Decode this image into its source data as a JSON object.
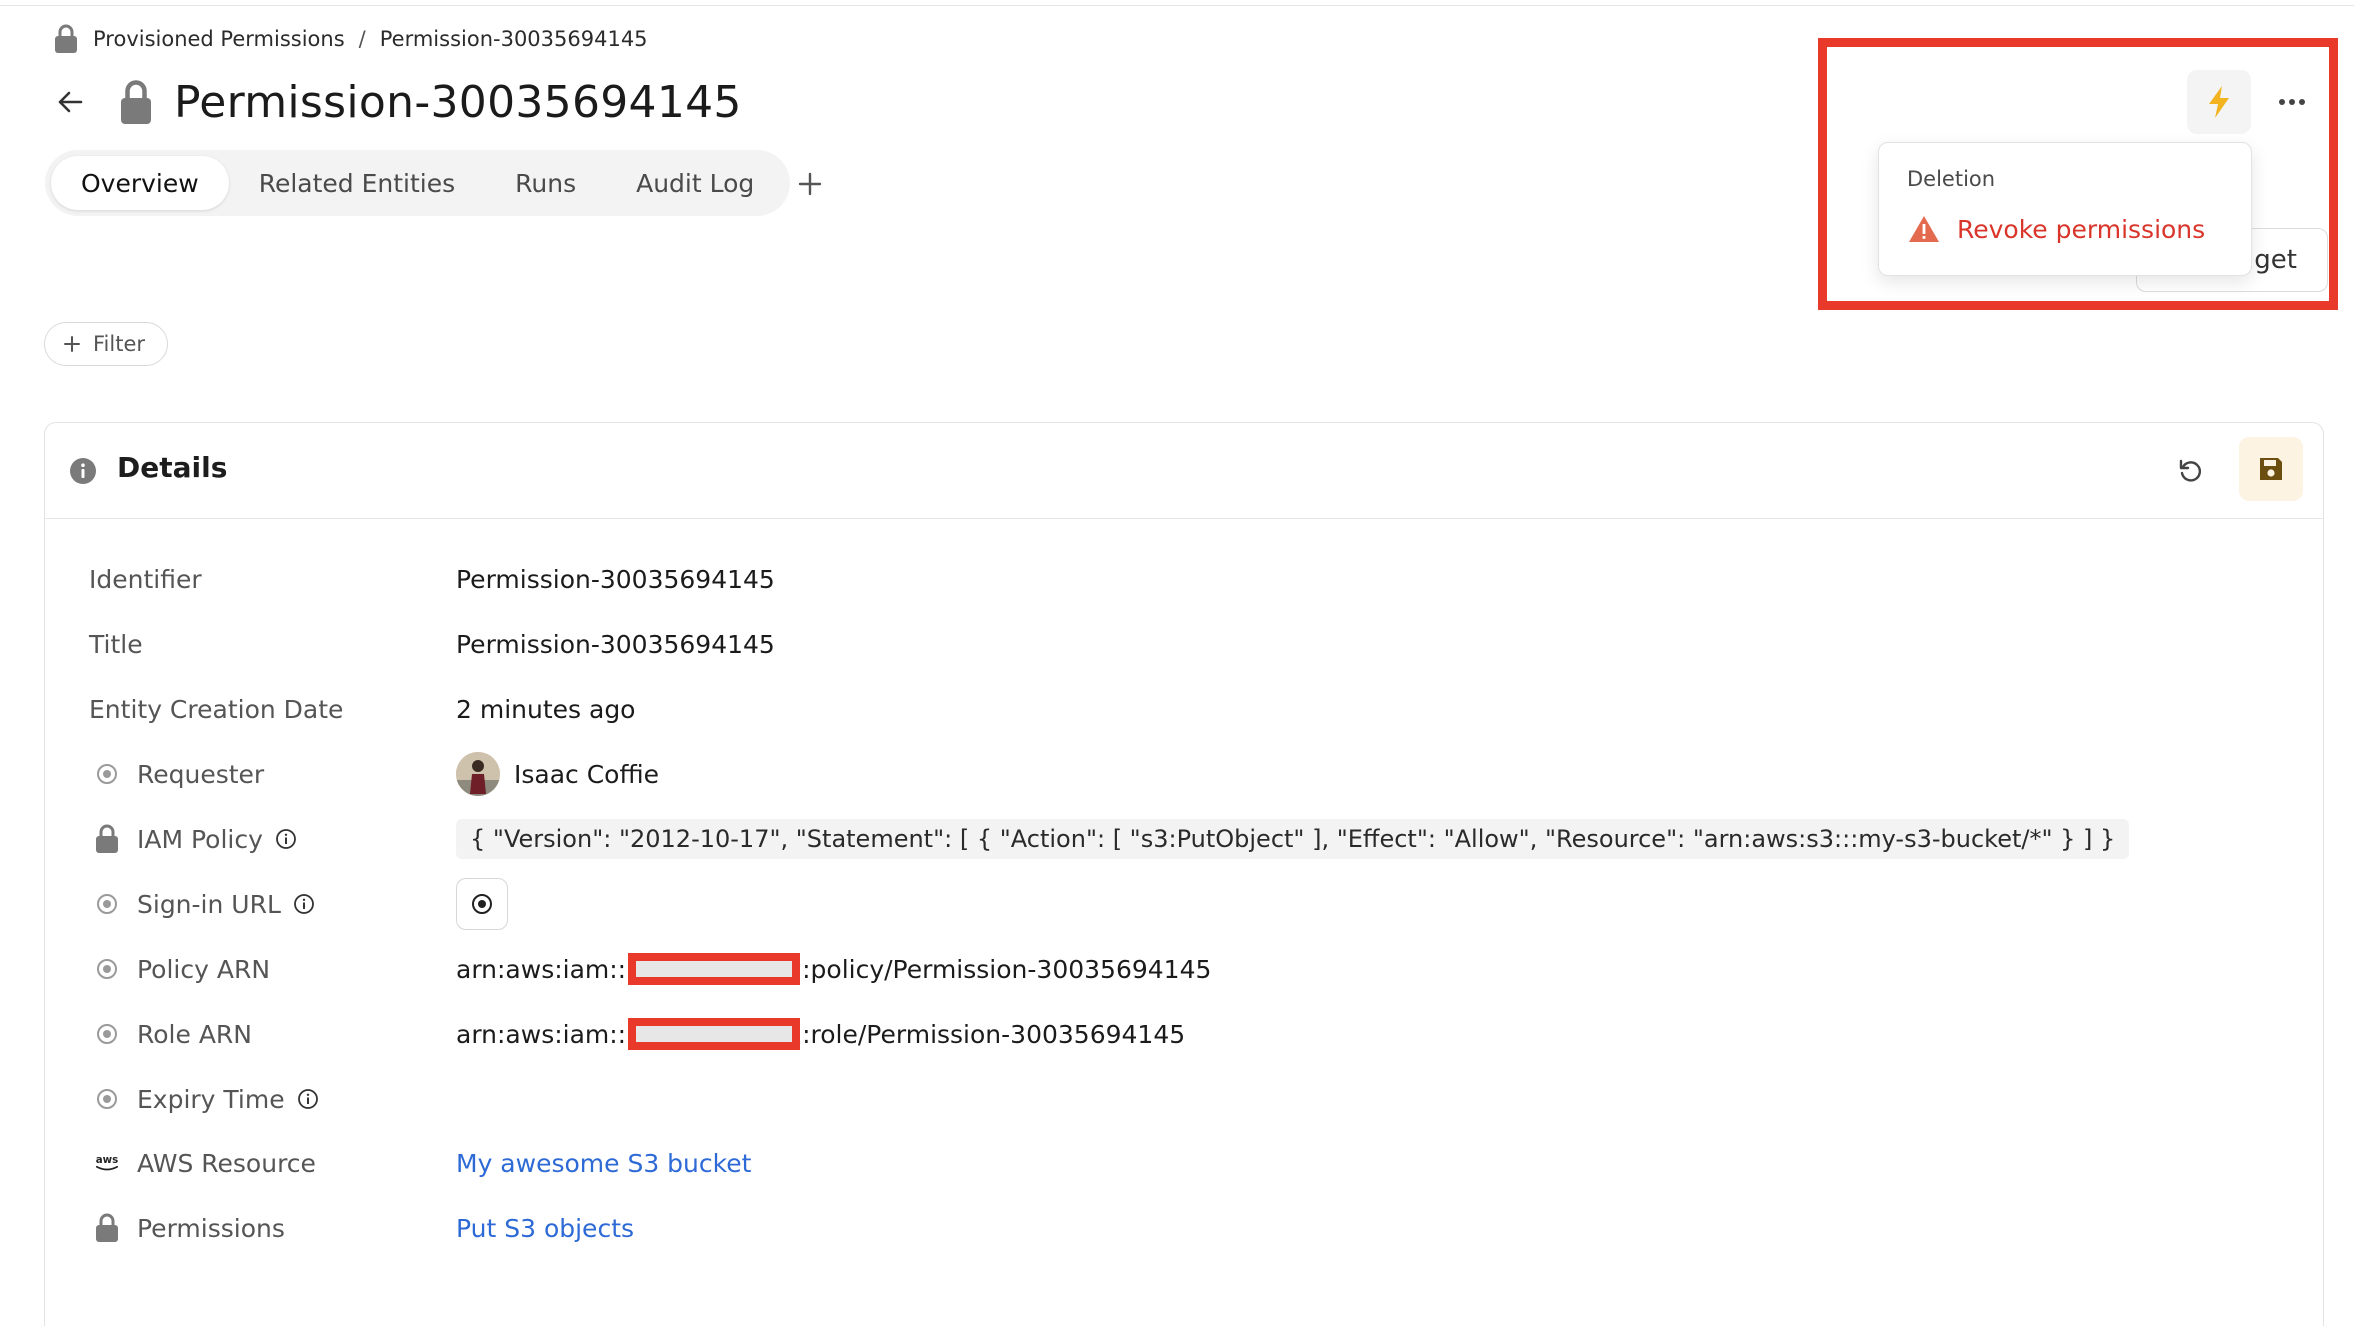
{
  "breadcrumb": {
    "parent": "Provisioned Permissions",
    "separator": "/",
    "current": "Permission-30035694145"
  },
  "header": {
    "title": "Permission-30035694145"
  },
  "tabs": [
    {
      "label": "Overview",
      "active": true
    },
    {
      "label": "Related Entities",
      "active": false
    },
    {
      "label": "Runs",
      "active": false
    },
    {
      "label": "Audit Log",
      "active": false
    }
  ],
  "filter": {
    "label": "Filter"
  },
  "actions_menu": {
    "heading": "Deletion",
    "item": "Revoke permissions",
    "widget_partial": "lget"
  },
  "details": {
    "title": "Details",
    "rows": {
      "identifier": {
        "label": "Identifier",
        "value": "Permission-30035694145"
      },
      "title": {
        "label": "Title",
        "value": "Permission-30035694145"
      },
      "creation": {
        "label": "Entity Creation Date",
        "value": "2 minutes ago"
      },
      "requester": {
        "label": "Requester",
        "value": "Isaac Coffie"
      },
      "iam_policy": {
        "label": "IAM Policy",
        "value": "{ \"Version\": \"2012-10-17\", \"Statement\": [ { \"Action\": [ \"s3:PutObject\" ], \"Effect\": \"Allow\", \"Resource\": \"arn:aws:s3:::my-s3-bucket/*\" } ] }"
      },
      "signin_url": {
        "label": "Sign-in URL"
      },
      "policy_arn": {
        "label": "Policy ARN",
        "prefix": "arn:aws:iam::",
        "suffix": ":policy/Permission-30035694145"
      },
      "role_arn": {
        "label": "Role ARN",
        "prefix": "arn:aws:iam::",
        "suffix": ":role/Permission-30035694145"
      },
      "expiry": {
        "label": "Expiry Time",
        "value": ""
      },
      "aws_resource": {
        "label": "AWS Resource",
        "value": "My awesome S3 bucket"
      },
      "permissions": {
        "label": "Permissions",
        "value": "Put S3 objects"
      }
    }
  },
  "icons": {
    "aws_logo_text": "aws"
  },
  "colors": {
    "accent_warning": "#d9352a",
    "link": "#2d6ad6",
    "zap": "#f2b321",
    "highlight": "#e8392a"
  }
}
